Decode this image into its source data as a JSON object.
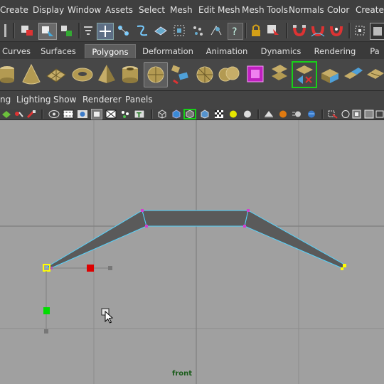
{
  "menubar": {
    "items": [
      "Create",
      "Display",
      "Window",
      "Assets",
      "Select",
      "Mesh",
      "Edit Mesh",
      "Mesh Tools",
      "Normals",
      "Color",
      "Create U"
    ]
  },
  "shelf_tabs": {
    "tabs": [
      "Curves",
      "Surfaces",
      "Polygons",
      "Deformation",
      "Animation",
      "Dynamics",
      "Rendering",
      "Pa"
    ],
    "active": "Polygons"
  },
  "panel_menu": {
    "items": [
      "ng",
      "Lighting",
      "Show",
      "Renderer",
      "Panels"
    ]
  },
  "viewport": {
    "camera_label": "front"
  },
  "colors": {
    "menubar_bg": "#3f3f3f",
    "viewport_bg": "#a0a0a0",
    "grid": "#8c8c8c",
    "mesh_fill": "#5a5a5a",
    "mesh_edge": "#55d4ff",
    "vertex": "#d040d0",
    "selected_vertex": "#ffff00",
    "manipulator_x": "#dd0000",
    "manipulator_y": "#00dd00",
    "camera_label": "#1a5c1a"
  }
}
